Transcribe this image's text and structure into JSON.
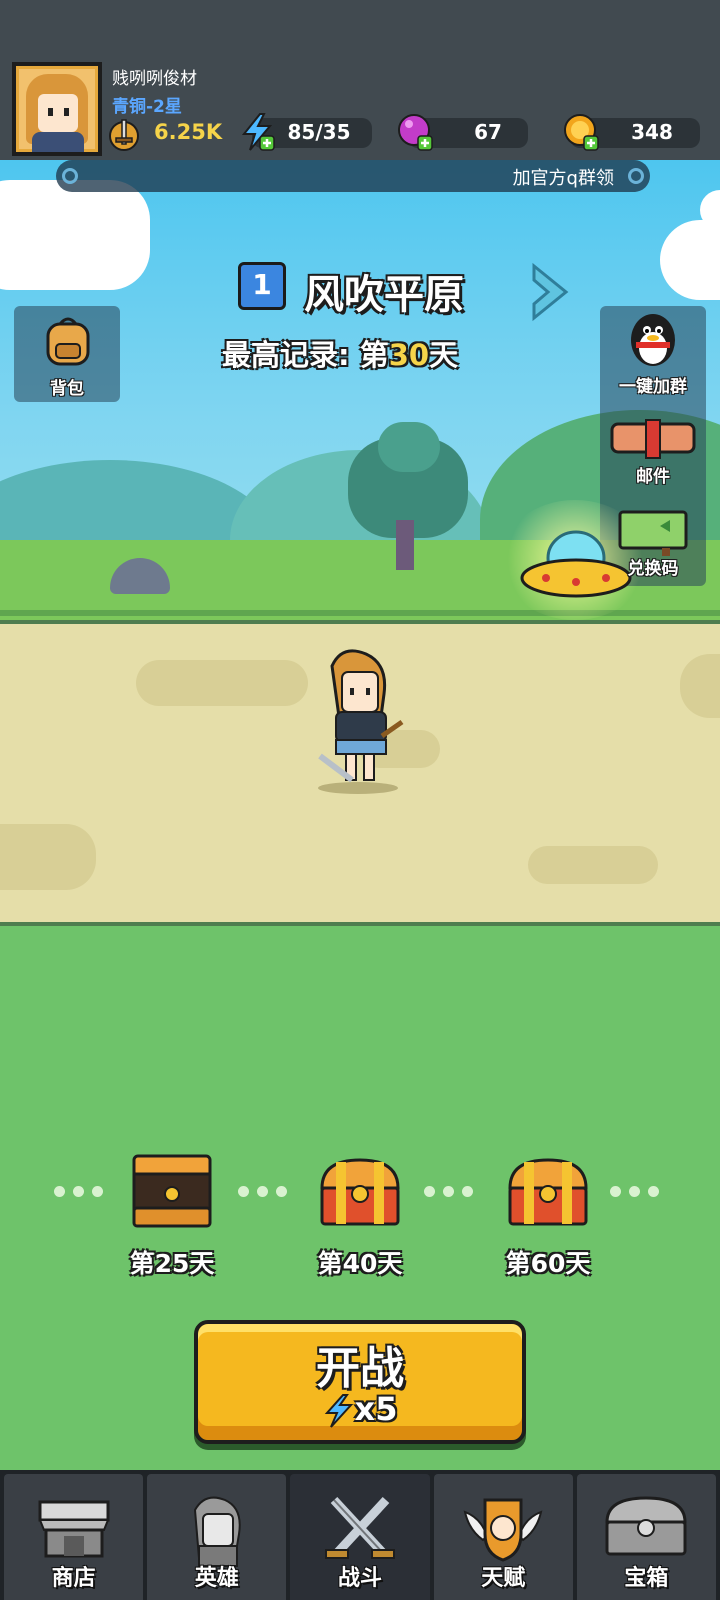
{
  "player": {
    "name": "贱咧咧俊材",
    "rank": "青铜-2星",
    "power": "6.25K"
  },
  "resources": {
    "energy": "85/35",
    "gems": "67",
    "coins": "348"
  },
  "announcement": "加官方q群领",
  "stage": {
    "number": "1",
    "name": "风吹平原",
    "record_prefix": "最高记录: 第",
    "record_days": "30",
    "record_suffix": "天"
  },
  "side_buttons": {
    "backpack": "背包",
    "join_group": "一键加群",
    "mail": "邮件",
    "redeem_code": "兑换码"
  },
  "chests": [
    {
      "label": "第25天"
    },
    {
      "label": "第40天"
    },
    {
      "label": "第60天"
    }
  ],
  "fight_button": {
    "label": "开战",
    "cost": "x5"
  },
  "tabs": [
    {
      "label": "商店",
      "icon": "shop-icon"
    },
    {
      "label": "英雄",
      "icon": "hero-icon"
    },
    {
      "label": "战斗",
      "icon": "crossed-swords-icon"
    },
    {
      "label": "天赋",
      "icon": "talent-fist-icon"
    },
    {
      "label": "宝箱",
      "icon": "treasure-chest-icon"
    }
  ],
  "colors": {
    "accent_yellow": "#f6d44a",
    "rank_blue": "#5ba7ff",
    "button_orange": "#f5b81f",
    "grass_green": "#6ec36a"
  }
}
